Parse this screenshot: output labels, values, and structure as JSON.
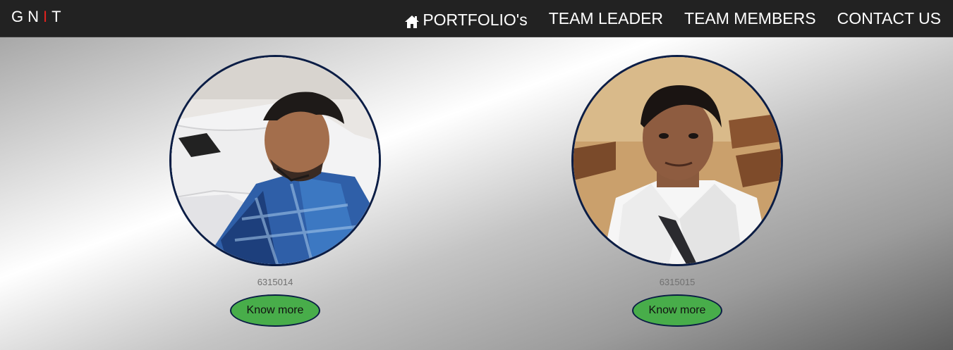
{
  "brand": {
    "letters": [
      "G",
      "N",
      "I",
      "T"
    ],
    "accent_color": "#e0221e"
  },
  "nav": {
    "items": [
      {
        "label": "PORTFOLIO's",
        "icon": "home-icon"
      },
      {
        "label": "TEAM LEADER"
      },
      {
        "label": "TEAM MEMBERS"
      },
      {
        "label": "CONTACT US"
      }
    ]
  },
  "members": [
    {
      "id": "6315014",
      "button_label": "Know more"
    },
    {
      "id": "6315015",
      "button_label": "Know more"
    }
  ],
  "colors": {
    "navbar_bg": "#222222",
    "button_green": "#48ad4a",
    "photo_border": "#0b1d45"
  }
}
